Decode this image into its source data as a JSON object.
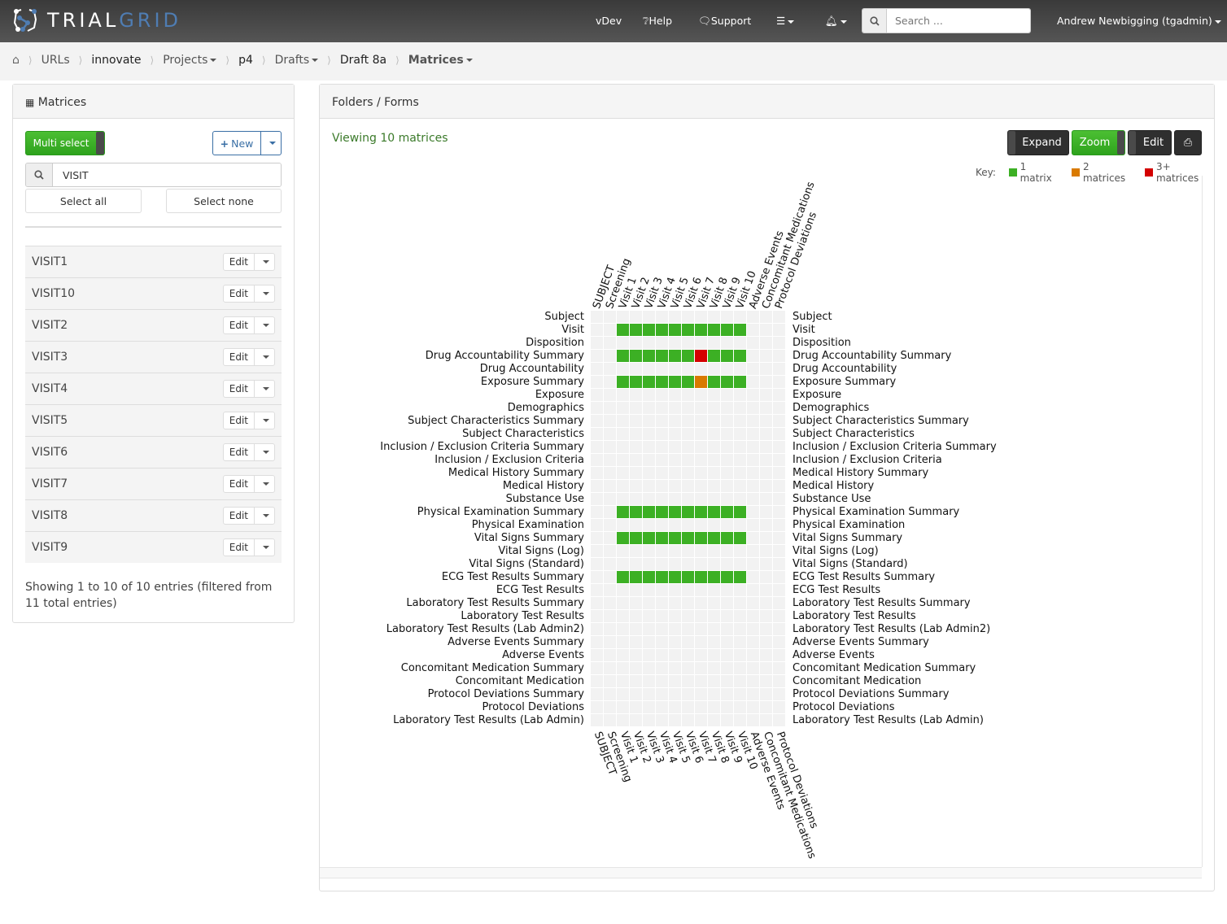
{
  "app": {
    "brand_light": "TRIAL",
    "brand_accent": "GRID"
  },
  "topnav": {
    "version": "vDev",
    "help": "Help",
    "support": "Support",
    "search_placeholder": "Search ...",
    "user": "Andrew Newbigging (tgadmin)"
  },
  "breadcrumb": [
    {
      "label": "URLs",
      "dropdown": false
    },
    {
      "label": "innovate",
      "dropdown": false
    },
    {
      "label": "Projects",
      "dropdown": true
    },
    {
      "label": "p4",
      "dropdown": false
    },
    {
      "label": "Drafts",
      "dropdown": true
    },
    {
      "label": "Draft 8a",
      "dropdown": false
    },
    {
      "label": "Matrices",
      "dropdown": true
    }
  ],
  "left_panel": {
    "title": "Matrices",
    "multi_select": "Multi select",
    "new": "New",
    "filter_value": "VISIT",
    "select_all": "Select all",
    "select_none": "Select none",
    "edit_label": "Edit",
    "items": [
      "VISIT1",
      "VISIT10",
      "VISIT2",
      "VISIT3",
      "VISIT4",
      "VISIT5",
      "VISIT6",
      "VISIT7",
      "VISIT8",
      "VISIT9"
    ],
    "showing": "Showing 1 to 10 of 10 entries (filtered from 11 total entries)"
  },
  "right_panel": {
    "title": "Folders / Forms",
    "viewing": "Viewing 10 matrices",
    "buttons": {
      "expand": "Expand",
      "zoom": "Zoom",
      "edit": "Edit"
    },
    "key_label": "Key:",
    "key": [
      {
        "label": "1 matrix",
        "color": "#3cb024"
      },
      {
        "label": "2 matrices",
        "color": "#d97a00"
      },
      {
        "label": "3+ matrices",
        "color": "#d40000"
      }
    ]
  },
  "chart_data": {
    "type": "heatmap",
    "columns": [
      "SUBJECT",
      "Screening",
      "Visit 1",
      "Visit 2",
      "Visit 3",
      "Visit 4",
      "Visit 5",
      "Visit 6",
      "Visit 7",
      "Visit 8",
      "Visit 9",
      "Visit 10",
      "Adverse Events",
      "Concomitant Medications",
      "Protocol Deviations"
    ],
    "rows": [
      "Subject",
      "Visit",
      "Disposition",
      "Drug Accountability Summary",
      "Drug Accountability",
      "Exposure Summary",
      "Exposure",
      "Demographics",
      "Subject Characteristics Summary",
      "Subject Characteristics",
      "Inclusion / Exclusion Criteria Summary",
      "Inclusion / Exclusion Criteria",
      "Medical History Summary",
      "Medical History",
      "Substance Use",
      "Physical Examination Summary",
      "Physical Examination",
      "Vital Signs Summary",
      "Vital Signs (Log)",
      "Vital Signs (Standard)",
      "ECG Test Results Summary",
      "ECG Test Results",
      "Laboratory Test Results Summary",
      "Laboratory Test Results",
      "Laboratory Test Results (Lab Admin2)",
      "Adverse Events Summary",
      "Adverse Events",
      "Concomitant Medication Summary",
      "Concomitant Medication",
      "Protocol Deviations Summary",
      "Protocol Deviations",
      "Laboratory Test Results (Lab Admin)"
    ],
    "values": [
      [
        0,
        0,
        0,
        0,
        0,
        0,
        0,
        0,
        0,
        0,
        0,
        0,
        0,
        0,
        0
      ],
      [
        0,
        0,
        1,
        1,
        1,
        1,
        1,
        1,
        1,
        1,
        1,
        1,
        0,
        0,
        0
      ],
      [
        0,
        0,
        0,
        0,
        0,
        0,
        0,
        0,
        0,
        0,
        0,
        0,
        0,
        0,
        0
      ],
      [
        0,
        0,
        1,
        1,
        1,
        1,
        1,
        1,
        3,
        1,
        1,
        1,
        0,
        0,
        0
      ],
      [
        0,
        0,
        0,
        0,
        0,
        0,
        0,
        0,
        0,
        0,
        0,
        0,
        0,
        0,
        0
      ],
      [
        0,
        0,
        1,
        1,
        1,
        1,
        1,
        1,
        2,
        1,
        1,
        1,
        0,
        0,
        0
      ],
      [
        0,
        0,
        0,
        0,
        0,
        0,
        0,
        0,
        0,
        0,
        0,
        0,
        0,
        0,
        0
      ],
      [
        0,
        0,
        0,
        0,
        0,
        0,
        0,
        0,
        0,
        0,
        0,
        0,
        0,
        0,
        0
      ],
      [
        0,
        0,
        0,
        0,
        0,
        0,
        0,
        0,
        0,
        0,
        0,
        0,
        0,
        0,
        0
      ],
      [
        0,
        0,
        0,
        0,
        0,
        0,
        0,
        0,
        0,
        0,
        0,
        0,
        0,
        0,
        0
      ],
      [
        0,
        0,
        0,
        0,
        0,
        0,
        0,
        0,
        0,
        0,
        0,
        0,
        0,
        0,
        0
      ],
      [
        0,
        0,
        0,
        0,
        0,
        0,
        0,
        0,
        0,
        0,
        0,
        0,
        0,
        0,
        0
      ],
      [
        0,
        0,
        0,
        0,
        0,
        0,
        0,
        0,
        0,
        0,
        0,
        0,
        0,
        0,
        0
      ],
      [
        0,
        0,
        0,
        0,
        0,
        0,
        0,
        0,
        0,
        0,
        0,
        0,
        0,
        0,
        0
      ],
      [
        0,
        0,
        0,
        0,
        0,
        0,
        0,
        0,
        0,
        0,
        0,
        0,
        0,
        0,
        0
      ],
      [
        0,
        0,
        1,
        1,
        1,
        1,
        1,
        1,
        1,
        1,
        1,
        1,
        0,
        0,
        0
      ],
      [
        0,
        0,
        0,
        0,
        0,
        0,
        0,
        0,
        0,
        0,
        0,
        0,
        0,
        0,
        0
      ],
      [
        0,
        0,
        1,
        1,
        1,
        1,
        1,
        1,
        1,
        1,
        1,
        1,
        0,
        0,
        0
      ],
      [
        0,
        0,
        0,
        0,
        0,
        0,
        0,
        0,
        0,
        0,
        0,
        0,
        0,
        0,
        0
      ],
      [
        0,
        0,
        0,
        0,
        0,
        0,
        0,
        0,
        0,
        0,
        0,
        0,
        0,
        0,
        0
      ],
      [
        0,
        0,
        1,
        1,
        1,
        1,
        1,
        1,
        1,
        1,
        1,
        1,
        0,
        0,
        0
      ],
      [
        0,
        0,
        0,
        0,
        0,
        0,
        0,
        0,
        0,
        0,
        0,
        0,
        0,
        0,
        0
      ],
      [
        0,
        0,
        0,
        0,
        0,
        0,
        0,
        0,
        0,
        0,
        0,
        0,
        0,
        0,
        0
      ],
      [
        0,
        0,
        0,
        0,
        0,
        0,
        0,
        0,
        0,
        0,
        0,
        0,
        0,
        0,
        0
      ],
      [
        0,
        0,
        0,
        0,
        0,
        0,
        0,
        0,
        0,
        0,
        0,
        0,
        0,
        0,
        0
      ],
      [
        0,
        0,
        0,
        0,
        0,
        0,
        0,
        0,
        0,
        0,
        0,
        0,
        0,
        0,
        0
      ],
      [
        0,
        0,
        0,
        0,
        0,
        0,
        0,
        0,
        0,
        0,
        0,
        0,
        0,
        0,
        0
      ],
      [
        0,
        0,
        0,
        0,
        0,
        0,
        0,
        0,
        0,
        0,
        0,
        0,
        0,
        0,
        0
      ],
      [
        0,
        0,
        0,
        0,
        0,
        0,
        0,
        0,
        0,
        0,
        0,
        0,
        0,
        0,
        0
      ],
      [
        0,
        0,
        0,
        0,
        0,
        0,
        0,
        0,
        0,
        0,
        0,
        0,
        0,
        0,
        0
      ],
      [
        0,
        0,
        0,
        0,
        0,
        0,
        0,
        0,
        0,
        0,
        0,
        0,
        0,
        0,
        0
      ],
      [
        0,
        0,
        0,
        0,
        0,
        0,
        0,
        0,
        0,
        0,
        0,
        0,
        0,
        0,
        0
      ]
    ],
    "color_scale": {
      "0": "#f2f2f2",
      "1": "#3cb024",
      "2": "#d97a00",
      "3": "#d40000"
    },
    "legend": [
      "1 matrix",
      "2 matrices",
      "3+ matrices"
    ],
    "legend_position": "top-right"
  }
}
